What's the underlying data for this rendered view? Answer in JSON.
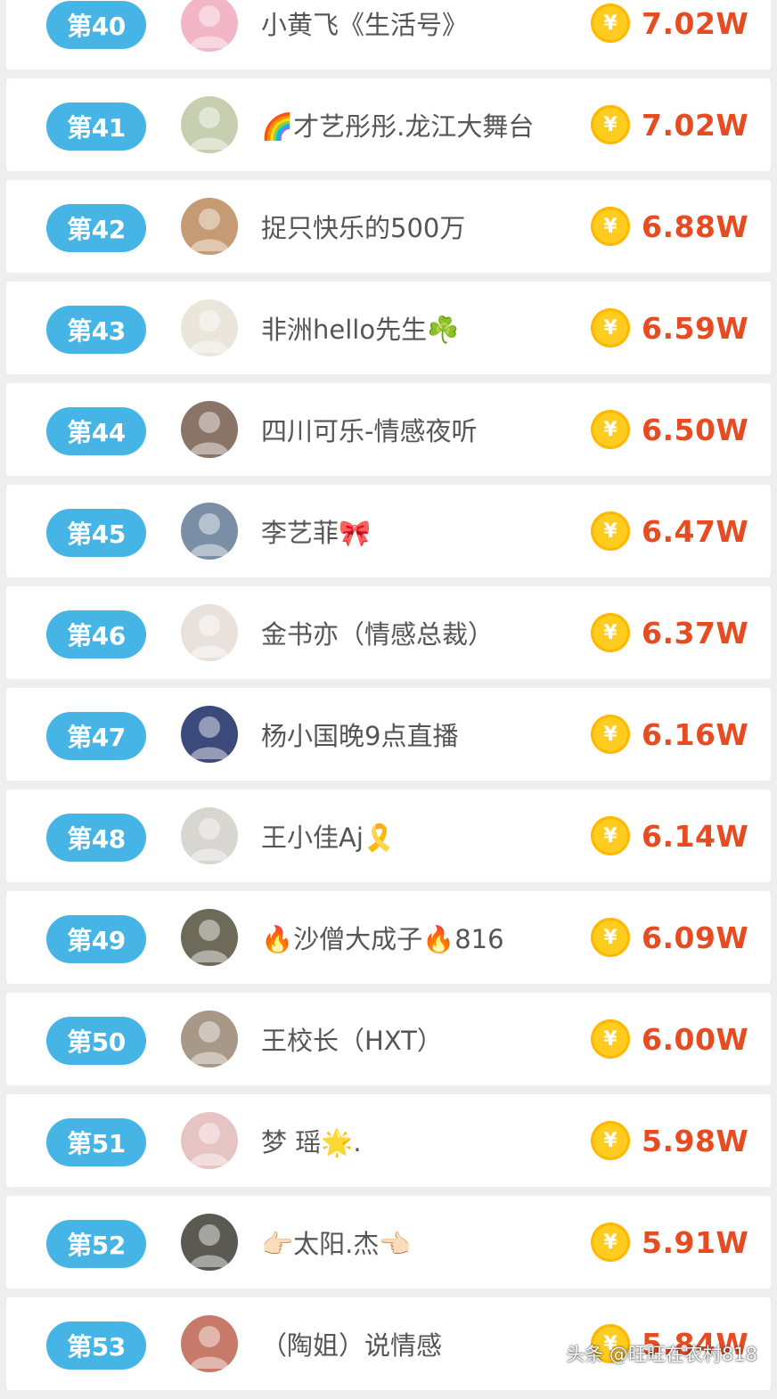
{
  "ranking": [
    {
      "rank": "第40",
      "name": "小黄飞《生活号》",
      "amount": "7.02W",
      "avatar_color": "#f3b6c6"
    },
    {
      "rank": "第41",
      "name": "🌈才艺彤彤.龙江大舞台",
      "amount": "7.02W",
      "avatar_color": "#c8cfb0"
    },
    {
      "rank": "第42",
      "name": "捉只快乐的500万",
      "amount": "6.88W",
      "avatar_color": "#c69a72"
    },
    {
      "rank": "第43",
      "name": "非洲hello先生☘️",
      "amount": "6.59W",
      "avatar_color": "#eae6dc"
    },
    {
      "rank": "第44",
      "name": "四川可乐-情感夜听",
      "amount": "6.50W",
      "avatar_color": "#8a7468"
    },
    {
      "rank": "第45",
      "name": "李艺菲🎀",
      "amount": "6.47W",
      "avatar_color": "#7a8fa6"
    },
    {
      "rank": "第46",
      "name": "金书亦（情感总裁）",
      "amount": "6.37W",
      "avatar_color": "#e9e2dc"
    },
    {
      "rank": "第47",
      "name": "杨小国晚9点直播",
      "amount": "6.16W",
      "avatar_color": "#3b4a7a"
    },
    {
      "rank": "第48",
      "name": "王小佳Aj🎗️",
      "amount": "6.14W",
      "avatar_color": "#d8d6d0"
    },
    {
      "rank": "第49",
      "name": "🔥沙僧大成子🔥816",
      "amount": "6.09W",
      "avatar_color": "#6e6a5a"
    },
    {
      "rank": "第50",
      "name": "王校长（HXT）",
      "amount": "6.00W",
      "avatar_color": "#a89888"
    },
    {
      "rank": "第51",
      "name": "梦 瑶🌟.",
      "amount": "5.98W",
      "avatar_color": "#e7c4c4"
    },
    {
      "rank": "第52",
      "name": "👉🏻太阳.杰👈🏻",
      "amount": "5.91W",
      "avatar_color": "#5a5a52"
    },
    {
      "rank": "第53",
      "name": "（陶姐）说情感",
      "amount": "5.84W",
      "avatar_color": "#c87a6a"
    }
  ],
  "coin_symbol": "¥",
  "watermark": "头条 @旺旺在农村818",
  "colors": {
    "rank_badge": "#46b5e6",
    "amount": "#e64b22",
    "coin": "#ffcc1f"
  }
}
